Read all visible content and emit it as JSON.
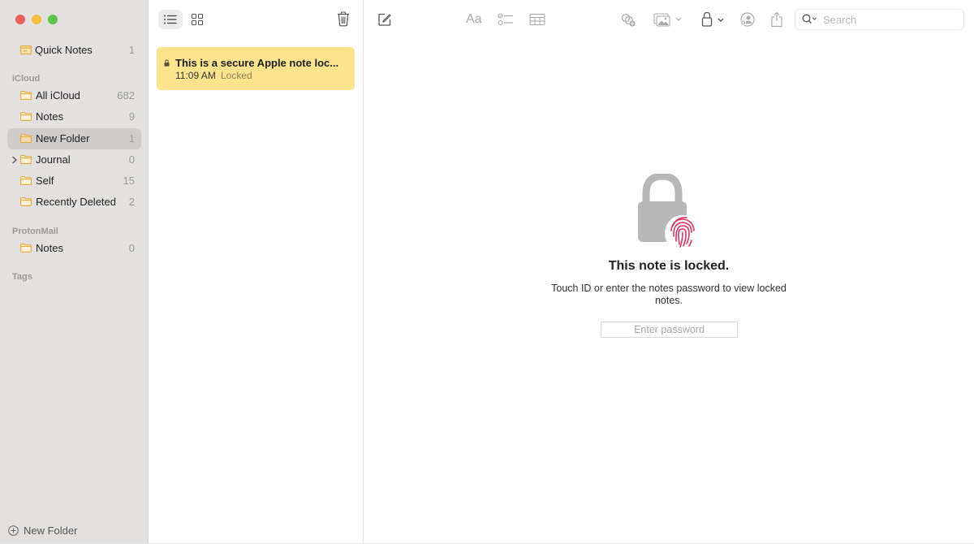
{
  "window": {
    "controls": [
      "close",
      "minimize",
      "maximize"
    ]
  },
  "sidebar": {
    "pinned": [
      {
        "label": "Quick Notes",
        "count": "1",
        "icon": "quick-notes-icon"
      }
    ],
    "sections": [
      {
        "label": "iCloud",
        "items": [
          {
            "label": "All iCloud",
            "count": "682",
            "icon": "folder-icon"
          },
          {
            "label": "Notes",
            "count": "9",
            "icon": "folder-icon"
          },
          {
            "label": "New Folder",
            "count": "1",
            "icon": "folder-icon",
            "selected": true
          },
          {
            "label": "Journal",
            "count": "0",
            "icon": "folder-icon",
            "expandable": true
          },
          {
            "label": "Self",
            "count": "15",
            "icon": "folder-icon"
          },
          {
            "label": "Recently Deleted",
            "count": "2",
            "icon": "folder-icon"
          }
        ]
      },
      {
        "label": "ProtonMail",
        "items": [
          {
            "label": "Notes",
            "count": "0",
            "icon": "folder-icon"
          }
        ]
      },
      {
        "label": "Tags",
        "items": []
      }
    ],
    "new_folder_label": "New Folder"
  },
  "notelist": {
    "view_modes": [
      "list-view",
      "gallery-view"
    ],
    "active_view": "list-view",
    "notes": [
      {
        "title": "This is a secure Apple note loc...",
        "time": "11:09 AM",
        "status": "Locked",
        "locked": true
      }
    ]
  },
  "toolbar": {
    "icons": [
      "compose-icon",
      "format-text-icon",
      "checklist-icon",
      "table-icon",
      "collaborate-icon",
      "media-icon",
      "lock-icon",
      "share-note-icon",
      "share-icon"
    ],
    "search_placeholder": "Search"
  },
  "locked_view": {
    "title": "This note is locked.",
    "description": "Touch ID or enter the notes password to view locked notes.",
    "password_placeholder": "Enter password",
    "accent_color": "#e0335d"
  }
}
